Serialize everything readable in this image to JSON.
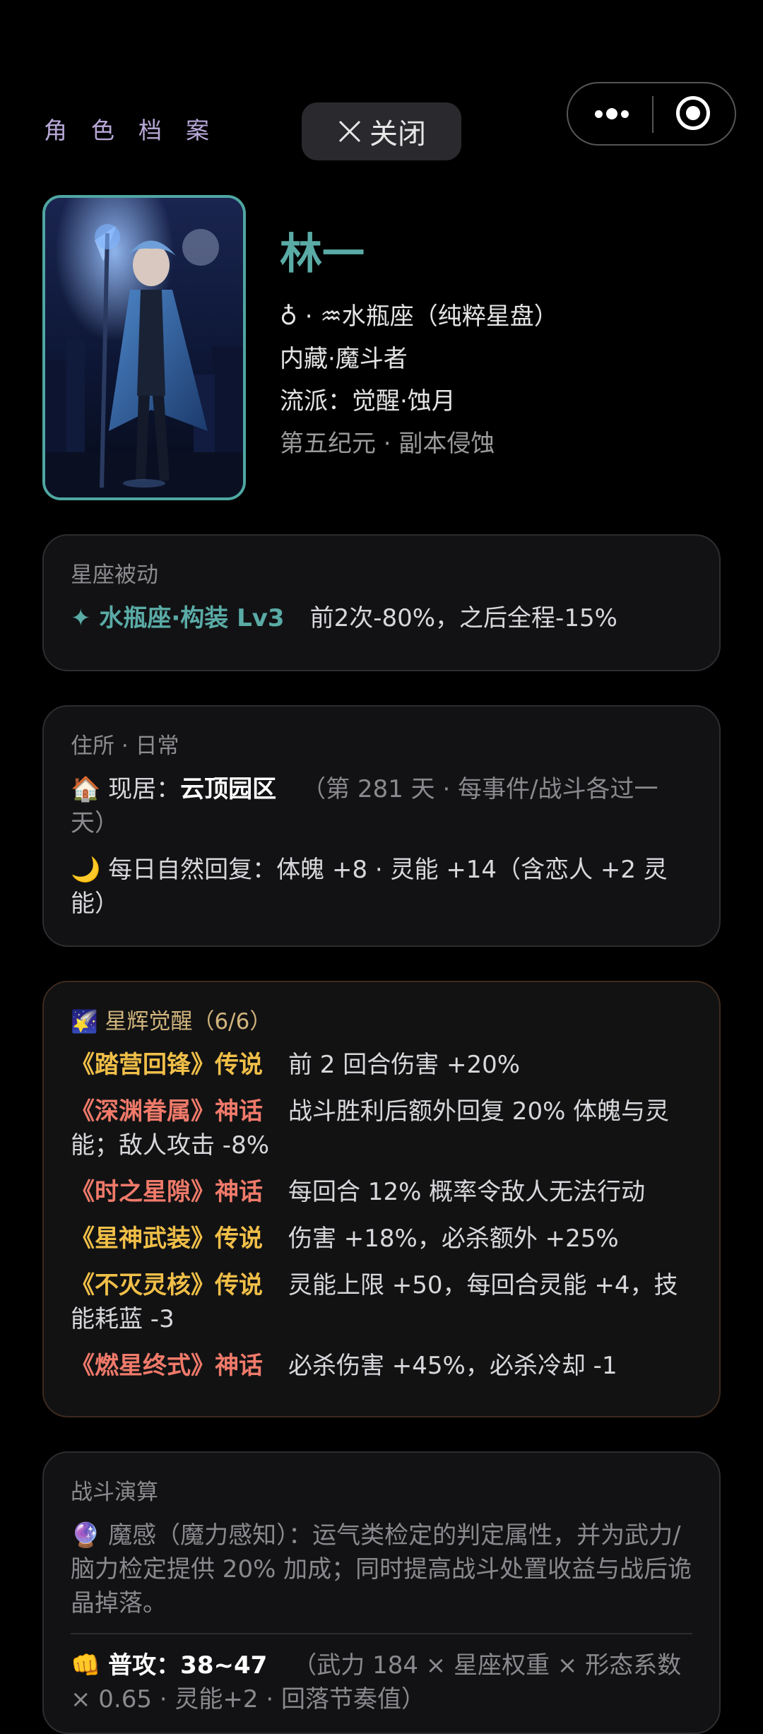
{
  "header": {
    "title": "角色档案",
    "close_label": "关闭"
  },
  "character": {
    "name": "林一",
    "zodiac_line": "♁ · ♒水瓶座（纯粹星盘）",
    "identity": "内藏·魔斗者",
    "school": "流派：觉醒·蚀月",
    "era": "第五纪元 · 副本侵蚀"
  },
  "passive": {
    "title": "星座被动",
    "skill": "✦ 水瓶座·构装 Lv3",
    "effect": "前2次-80%，之后全程-15%"
  },
  "residence": {
    "title": "住所 · 日常",
    "home_icon": "🏠",
    "home_label": "现居：",
    "home_name": "云顶园区",
    "home_note": "（第 281 天 · 每事件/战斗各过一天）",
    "recover_icon": "🌙",
    "recover_text": "每日自然回复：体魄 +8 · 灵能 +14（含恋人 +2 灵能）"
  },
  "awakening": {
    "title": "🌠 星辉觉醒（6/6）",
    "items": [
      {
        "name": "《踏营回锋》传说",
        "effect": "前 2 回合伤害 +20%",
        "tier": "legend"
      },
      {
        "name": "《深渊眷属》神话",
        "effect": "战斗胜利后额外回复 20% 体魄与灵能；敌人攻击 -8%",
        "tier": "myth"
      },
      {
        "name": "《时之星隙》神话",
        "effect": "每回合 12% 概率令敌人无法行动",
        "tier": "myth"
      },
      {
        "name": "《星神武装》传说",
        "effect": "伤害 +18%，必杀额外 +25%",
        "tier": "legend"
      },
      {
        "name": "《不灭灵核》传说",
        "effect": "灵能上限 +50，每回合灵能 +4，技能耗蓝 -3",
        "tier": "legend"
      },
      {
        "name": "《燃星终式》神话",
        "effect": "必杀伤害 +45%，必杀冷却 -1",
        "tier": "myth"
      }
    ]
  },
  "combat": {
    "title": "战斗演算",
    "sense_icon": "🔮",
    "sense_text": "魔感（魔力感知）：运气类检定的判定属性，并为武力/脑力检定提供 20% 加成；同时提高战斗处置收益与战后诡晶掉落。",
    "attack_icon": "👊",
    "attack_label": "普攻：",
    "attack_value": "38~47",
    "attack_note": "（武力 184 × 星座权重 × 形态系数 × 0.65 · 灵能+2 · 回落节奏值）"
  },
  "colors": {
    "accent_teal": "#5aaba6",
    "legend_gold": "#f0bf48",
    "myth_red": "#f07a6a",
    "header_purple": "#b8a8d8"
  }
}
